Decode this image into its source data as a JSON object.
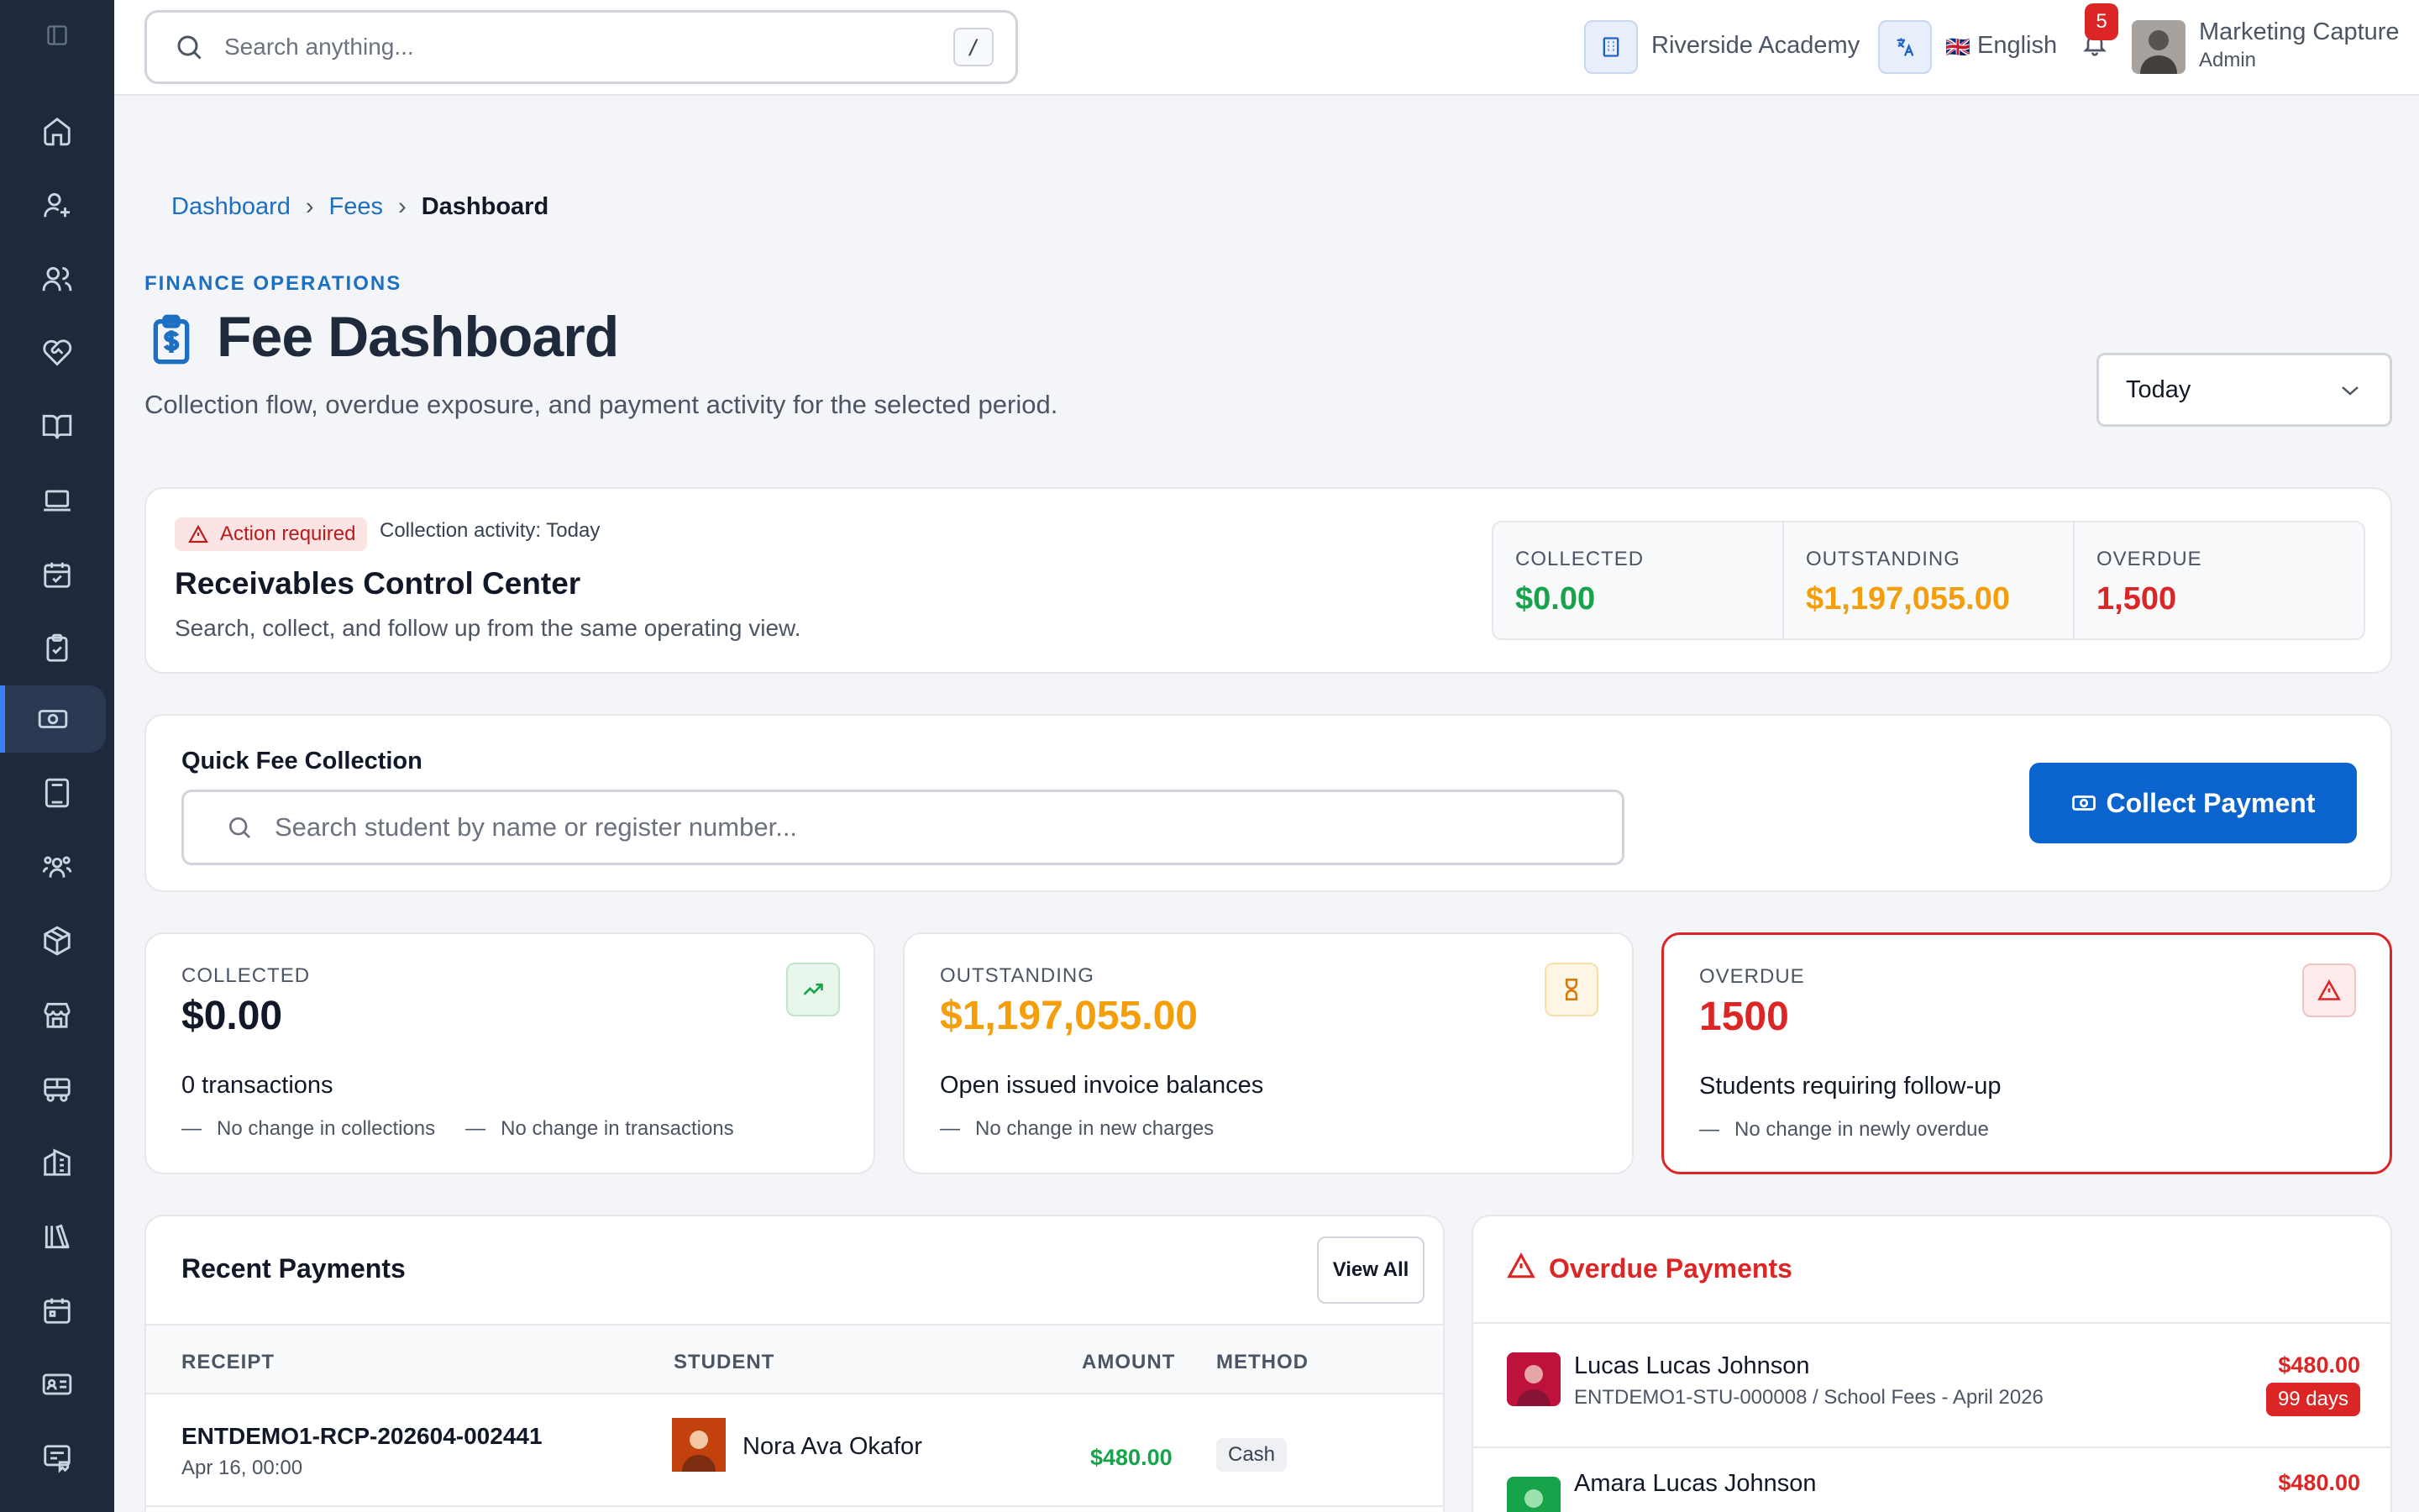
{
  "topbar": {
    "search_placeholder": "Search anything...",
    "search_shortcut": "/",
    "school": "Riverside Academy",
    "language_flag": "🇬🇧",
    "language": "English",
    "notification_count": "5",
    "user_name": "Marketing Capture",
    "user_role": "Admin"
  },
  "sidebar": {
    "items": [
      {
        "icon": "home-icon"
      },
      {
        "icon": "user-plus-icon"
      },
      {
        "icon": "users-icon"
      },
      {
        "icon": "heart-handshake-icon"
      },
      {
        "icon": "book-open-icon"
      },
      {
        "icon": "laptop-icon"
      },
      {
        "icon": "calendar-check-icon"
      },
      {
        "icon": "clipboard-check-icon"
      },
      {
        "icon": "banknote-icon",
        "active": true
      },
      {
        "icon": "calculator-icon"
      },
      {
        "icon": "users-group-icon"
      },
      {
        "icon": "package-icon"
      },
      {
        "icon": "store-icon"
      },
      {
        "icon": "bus-icon"
      },
      {
        "icon": "building-icon"
      },
      {
        "icon": "library-icon"
      },
      {
        "icon": "calendar-icon"
      },
      {
        "icon": "id-card-icon"
      },
      {
        "icon": "receipt-icon"
      }
    ]
  },
  "breadcrumb": {
    "items": [
      "Dashboard",
      "Fees",
      "Dashboard"
    ],
    "separator": "›"
  },
  "header": {
    "eyebrow": "FINANCE OPERATIONS",
    "title": "Fee Dashboard",
    "subtitle": "Collection flow, overdue exposure, and payment activity for the selected period.",
    "period": "Today"
  },
  "control_center": {
    "badge": "Action required",
    "activity": "Collection activity: Today",
    "title": "Receivables Control Center",
    "subtitle": "Search, collect, and follow up from the same operating view.",
    "stats": [
      {
        "label": "COLLECTED",
        "value": "$0.00",
        "color": "#16a34a"
      },
      {
        "label": "OUTSTANDING",
        "value": "$1,197,055.00",
        "color": "#f59e0b"
      },
      {
        "label": "OVERDUE",
        "value": "1,500",
        "color": "#dc2626"
      }
    ]
  },
  "quick_collect": {
    "title": "Quick Fee Collection",
    "placeholder": "Search student by name or register number...",
    "button": "Collect Payment"
  },
  "kpis": {
    "collected": {
      "label": "COLLECTED",
      "value": "$0.00",
      "desc": "0 transactions",
      "notes": [
        "No change in collections",
        "No change in transactions"
      ],
      "icon": "trending-up-icon"
    },
    "outstanding": {
      "label": "OUTSTANDING",
      "value": "$1,197,055.00",
      "desc": "Open issued invoice balances",
      "notes": [
        "No change in new charges"
      ],
      "icon": "hourglass-icon"
    },
    "overdue": {
      "label": "OVERDUE",
      "value": "1500",
      "desc": "Students requiring follow-up",
      "notes": [
        "No change in newly overdue"
      ],
      "icon": "alert-triangle-icon"
    }
  },
  "recent_payments": {
    "title": "Recent Payments",
    "view_all": "View All",
    "columns": [
      "RECEIPT",
      "STUDENT",
      "AMOUNT",
      "METHOD"
    ],
    "rows": [
      {
        "receipt": "ENTDEMO1-RCP-202604-002441",
        "date": "Apr 16, 00:00",
        "student": "Nora Ava Okafor",
        "amount": "$480.00",
        "method": "Cash"
      }
    ]
  },
  "overdue_payments": {
    "title": "Overdue Payments",
    "rows": [
      {
        "name": "Lucas Lucas Johnson",
        "sub": "ENTDEMO1-STU-000008 / School Fees - April 2026",
        "amount": "$480.00",
        "days": "99 days"
      },
      {
        "name": "Amara Lucas Johnson",
        "sub": "",
        "amount": "$480.00",
        "days": ""
      }
    ]
  }
}
